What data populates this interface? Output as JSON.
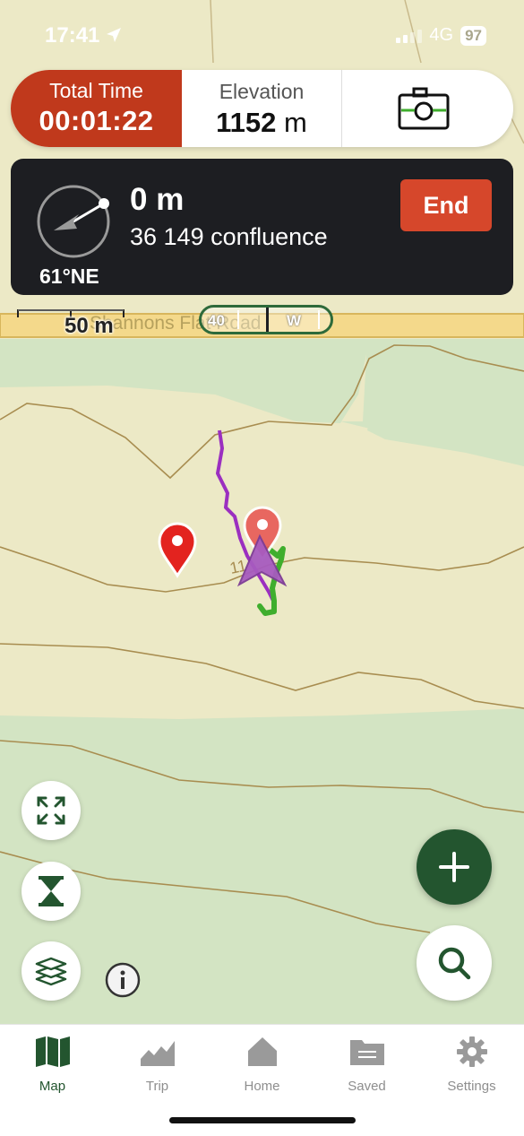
{
  "status_bar": {
    "time": "17:41",
    "network": "4G",
    "battery": "97"
  },
  "top_card": {
    "total_time_label": "Total Time",
    "total_time_value": "00:01:22",
    "elevation_label": "Elevation",
    "elevation_number": "1152",
    "elevation_unit": "m",
    "camera_icon": "camera-icon"
  },
  "navigation": {
    "distance": "0 m",
    "waypoint_name": "36 149 confluence",
    "bearing": "61°NE",
    "end_label": "End"
  },
  "map": {
    "scale_label": "50 m",
    "road_label": "Shannons Flat Road",
    "heading_tape": {
      "value": "40",
      "cardinal": "W"
    },
    "contour_label": "11"
  },
  "controls": {
    "fit_icon": "expand-icon",
    "hourglass_icon": "hourglass-icon",
    "layers_icon": "layers-icon",
    "info_icon": "info-icon",
    "add_icon": "plus-icon",
    "search_icon": "search-icon"
  },
  "tab_bar": {
    "tabs": [
      {
        "label": "Map",
        "icon": "map-icon",
        "active": true
      },
      {
        "label": "Trip",
        "icon": "chart-icon",
        "active": false
      },
      {
        "label": "Home",
        "icon": "home-icon",
        "active": false
      },
      {
        "label": "Saved",
        "icon": "folder-icon",
        "active": false
      },
      {
        "label": "Settings",
        "icon": "gear-icon",
        "active": false
      }
    ]
  },
  "colors": {
    "accent_green": "#23552f",
    "total_time_red": "#c0391c",
    "end_button_red": "#d6472b",
    "track_purple": "#9b2fc0",
    "track_green": "#3fae2d",
    "map_base": "#ece9c6",
    "map_vegetation": "#d2e4c2"
  }
}
